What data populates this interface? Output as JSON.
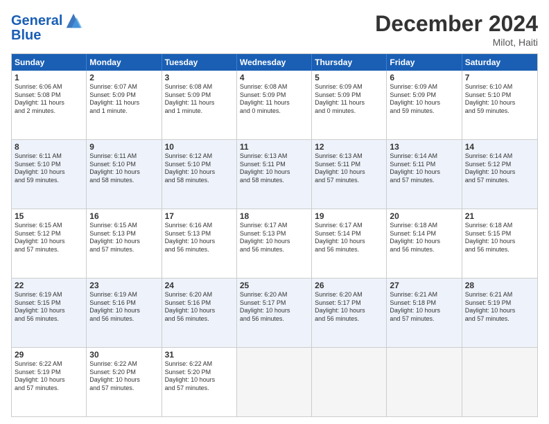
{
  "logo": {
    "line1": "General",
    "line2": "Blue"
  },
  "header": {
    "month_year": "December 2024",
    "location": "Milot, Haiti"
  },
  "weekdays": [
    "Sunday",
    "Monday",
    "Tuesday",
    "Wednesday",
    "Thursday",
    "Friday",
    "Saturday"
  ],
  "rows": [
    [
      {
        "day": "1",
        "lines": [
          "Sunrise: 6:06 AM",
          "Sunset: 5:08 PM",
          "Daylight: 11 hours",
          "and 2 minutes."
        ]
      },
      {
        "day": "2",
        "lines": [
          "Sunrise: 6:07 AM",
          "Sunset: 5:09 PM",
          "Daylight: 11 hours",
          "and 1 minute."
        ]
      },
      {
        "day": "3",
        "lines": [
          "Sunrise: 6:08 AM",
          "Sunset: 5:09 PM",
          "Daylight: 11 hours",
          "and 1 minute."
        ]
      },
      {
        "day": "4",
        "lines": [
          "Sunrise: 6:08 AM",
          "Sunset: 5:09 PM",
          "Daylight: 11 hours",
          "and 0 minutes."
        ]
      },
      {
        "day": "5",
        "lines": [
          "Sunrise: 6:09 AM",
          "Sunset: 5:09 PM",
          "Daylight: 11 hours",
          "and 0 minutes."
        ]
      },
      {
        "day": "6",
        "lines": [
          "Sunrise: 6:09 AM",
          "Sunset: 5:09 PM",
          "Daylight: 10 hours",
          "and 59 minutes."
        ]
      },
      {
        "day": "7",
        "lines": [
          "Sunrise: 6:10 AM",
          "Sunset: 5:10 PM",
          "Daylight: 10 hours",
          "and 59 minutes."
        ]
      }
    ],
    [
      {
        "day": "8",
        "lines": [
          "Sunrise: 6:11 AM",
          "Sunset: 5:10 PM",
          "Daylight: 10 hours",
          "and 59 minutes."
        ]
      },
      {
        "day": "9",
        "lines": [
          "Sunrise: 6:11 AM",
          "Sunset: 5:10 PM",
          "Daylight: 10 hours",
          "and 58 minutes."
        ]
      },
      {
        "day": "10",
        "lines": [
          "Sunrise: 6:12 AM",
          "Sunset: 5:10 PM",
          "Daylight: 10 hours",
          "and 58 minutes."
        ]
      },
      {
        "day": "11",
        "lines": [
          "Sunrise: 6:13 AM",
          "Sunset: 5:11 PM",
          "Daylight: 10 hours",
          "and 58 minutes."
        ]
      },
      {
        "day": "12",
        "lines": [
          "Sunrise: 6:13 AM",
          "Sunset: 5:11 PM",
          "Daylight: 10 hours",
          "and 57 minutes."
        ]
      },
      {
        "day": "13",
        "lines": [
          "Sunrise: 6:14 AM",
          "Sunset: 5:11 PM",
          "Daylight: 10 hours",
          "and 57 minutes."
        ]
      },
      {
        "day": "14",
        "lines": [
          "Sunrise: 6:14 AM",
          "Sunset: 5:12 PM",
          "Daylight: 10 hours",
          "and 57 minutes."
        ]
      }
    ],
    [
      {
        "day": "15",
        "lines": [
          "Sunrise: 6:15 AM",
          "Sunset: 5:12 PM",
          "Daylight: 10 hours",
          "and 57 minutes."
        ]
      },
      {
        "day": "16",
        "lines": [
          "Sunrise: 6:15 AM",
          "Sunset: 5:13 PM",
          "Daylight: 10 hours",
          "and 57 minutes."
        ]
      },
      {
        "day": "17",
        "lines": [
          "Sunrise: 6:16 AM",
          "Sunset: 5:13 PM",
          "Daylight: 10 hours",
          "and 56 minutes."
        ]
      },
      {
        "day": "18",
        "lines": [
          "Sunrise: 6:17 AM",
          "Sunset: 5:13 PM",
          "Daylight: 10 hours",
          "and 56 minutes."
        ]
      },
      {
        "day": "19",
        "lines": [
          "Sunrise: 6:17 AM",
          "Sunset: 5:14 PM",
          "Daylight: 10 hours",
          "and 56 minutes."
        ]
      },
      {
        "day": "20",
        "lines": [
          "Sunrise: 6:18 AM",
          "Sunset: 5:14 PM",
          "Daylight: 10 hours",
          "and 56 minutes."
        ]
      },
      {
        "day": "21",
        "lines": [
          "Sunrise: 6:18 AM",
          "Sunset: 5:15 PM",
          "Daylight: 10 hours",
          "and 56 minutes."
        ]
      }
    ],
    [
      {
        "day": "22",
        "lines": [
          "Sunrise: 6:19 AM",
          "Sunset: 5:15 PM",
          "Daylight: 10 hours",
          "and 56 minutes."
        ]
      },
      {
        "day": "23",
        "lines": [
          "Sunrise: 6:19 AM",
          "Sunset: 5:16 PM",
          "Daylight: 10 hours",
          "and 56 minutes."
        ]
      },
      {
        "day": "24",
        "lines": [
          "Sunrise: 6:20 AM",
          "Sunset: 5:16 PM",
          "Daylight: 10 hours",
          "and 56 minutes."
        ]
      },
      {
        "day": "25",
        "lines": [
          "Sunrise: 6:20 AM",
          "Sunset: 5:17 PM",
          "Daylight: 10 hours",
          "and 56 minutes."
        ]
      },
      {
        "day": "26",
        "lines": [
          "Sunrise: 6:20 AM",
          "Sunset: 5:17 PM",
          "Daylight: 10 hours",
          "and 56 minutes."
        ]
      },
      {
        "day": "27",
        "lines": [
          "Sunrise: 6:21 AM",
          "Sunset: 5:18 PM",
          "Daylight: 10 hours",
          "and 57 minutes."
        ]
      },
      {
        "day": "28",
        "lines": [
          "Sunrise: 6:21 AM",
          "Sunset: 5:19 PM",
          "Daylight: 10 hours",
          "and 57 minutes."
        ]
      }
    ],
    [
      {
        "day": "29",
        "lines": [
          "Sunrise: 6:22 AM",
          "Sunset: 5:19 PM",
          "Daylight: 10 hours",
          "and 57 minutes."
        ]
      },
      {
        "day": "30",
        "lines": [
          "Sunrise: 6:22 AM",
          "Sunset: 5:20 PM",
          "Daylight: 10 hours",
          "and 57 minutes."
        ]
      },
      {
        "day": "31",
        "lines": [
          "Sunrise: 6:22 AM",
          "Sunset: 5:20 PM",
          "Daylight: 10 hours",
          "and 57 minutes."
        ]
      },
      {
        "day": "",
        "lines": []
      },
      {
        "day": "",
        "lines": []
      },
      {
        "day": "",
        "lines": []
      },
      {
        "day": "",
        "lines": []
      }
    ]
  ]
}
